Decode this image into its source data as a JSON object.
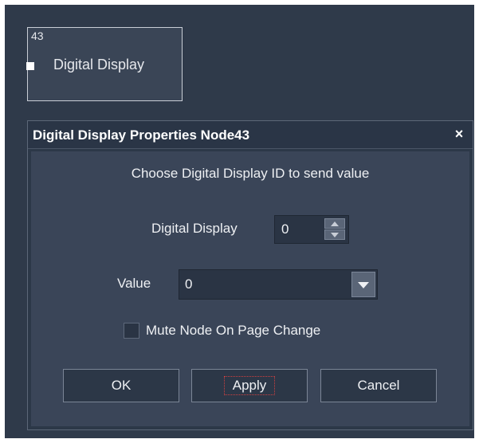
{
  "node": {
    "id": "43",
    "label": "Digital Display"
  },
  "dialog": {
    "title": "Digital Display Properties Node43",
    "close_label": "×",
    "instruction": "Choose Digital Display ID to send value",
    "digital_display": {
      "label": "Digital Display",
      "value": "0"
    },
    "value_field": {
      "label": "Value",
      "selected": "0"
    },
    "mute_checkbox": {
      "label": "Mute Node On Page Change",
      "checked": false
    },
    "buttons": {
      "ok": "OK",
      "apply": "Apply",
      "cancel": "Cancel"
    }
  },
  "icons": {
    "close": "close-icon",
    "spinner_up": "chevron-up-icon",
    "spinner_down": "chevron-down-icon",
    "dropdown": "chevron-down-icon",
    "node_port": "port-icon"
  },
  "colors": {
    "canvas_background": "#2f3a4a",
    "dialog_panel": "#3a4558",
    "focus_outline": "#d04040"
  }
}
